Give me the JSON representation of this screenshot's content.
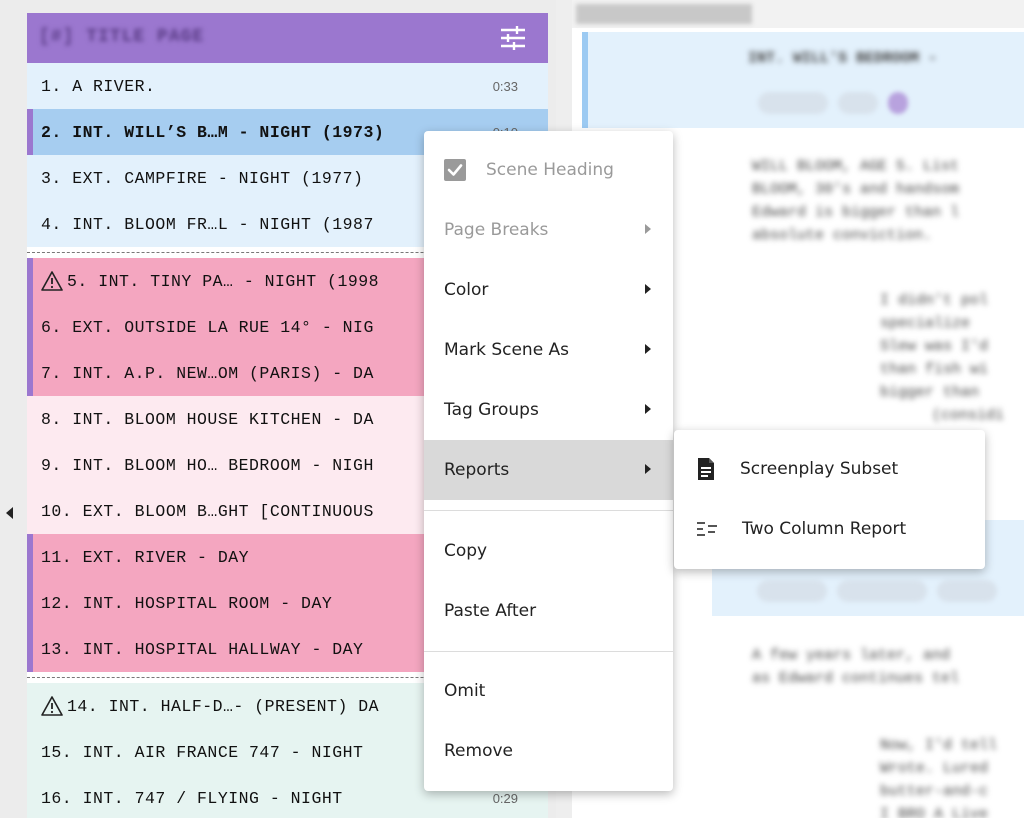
{
  "panel": {
    "title": "[#] TITLE PAGE",
    "filter_icon": "sliders-icon",
    "collapse_icon": "caret-left-icon"
  },
  "scenes_group1": [
    {
      "label": "1. A RIVER.",
      "duration": "0:33",
      "color": "#e3f1fc"
    },
    {
      "label": "2. INT. WILL’S B…M - NIGHT (1973)",
      "duration": "0:10",
      "color": "#a6cdf0",
      "selected": true
    },
    {
      "label": "3. EXT. CAMPFIRE - NIGHT (1977)",
      "duration": "",
      "color": "#e3f1fc"
    },
    {
      "label": "4. INT. BLOOM FR…L - NIGHT (1987",
      "duration": "",
      "color": "#e3f1fc"
    }
  ],
  "scenes_group2": [
    {
      "label": "5. INT. TINY PA… - NIGHT (1998",
      "warning": true,
      "color": "#f4a6c0"
    },
    {
      "label": "6. EXT. OUTSIDE LA RUE 14° - NIG",
      "color": "#f4a6c0"
    },
    {
      "label": "7. INT. A.P. NEW…OM (PARIS) - DA",
      "color": "#f4a6c0"
    },
    {
      "label": "8. INT. BLOOM HOUSE KITCHEN - DA",
      "color": "#fdeaf0"
    },
    {
      "label": "9. INT. BLOOM HO… BEDROOM - NIGH",
      "color": "#fdeaf0"
    },
    {
      "label": "10. EXT. BLOOM B…GHT [CONTINUOUS",
      "color": "#fdeaf0"
    },
    {
      "label": "11. EXT. RIVER - DAY",
      "color": "#f4a6c0"
    },
    {
      "label": "12. INT. HOSPITAL ROOM - DAY",
      "color": "#f4a6c0"
    },
    {
      "label": "13. INT. HOSPITAL HALLWAY - DAY",
      "color": "#f4a6c0"
    }
  ],
  "scenes_group3": [
    {
      "label": "14. INT. HALF-D…- (PRESENT) DA",
      "warning": true,
      "color": "#e6f4f1"
    },
    {
      "label": "15. INT. AIR FRANCE 747 - NIGHT",
      "color": "#e6f4f1"
    },
    {
      "label": "16. INT. 747 / FLYING - NIGHT",
      "duration": "0:29",
      "color": "#e6f4f1"
    }
  ],
  "context_menu": {
    "scene_heading": "Scene Heading",
    "page_breaks": "Page Breaks",
    "color": "Color",
    "mark_scene_as": "Mark Scene As",
    "tag_groups": "Tag Groups",
    "reports": "Reports",
    "copy": "Copy",
    "paste_after": "Paste After",
    "omit": "Omit",
    "remove": "Remove"
  },
  "reports_submenu": {
    "screenplay_subset": "Screenplay Subset",
    "two_column_report": "Two Column Report"
  },
  "editor": {
    "heading": "INT. WILL'S BEDROOM -",
    "lines": [
      "WILL BLOOM, AGE 5. List",
      "BLOOM, 30's and handsom",
      "Edward is bigger than l",
      "absolute conviction."
    ],
    "lines2": [
      "I didn't pol",
      "specialize",
      "Slew was I'd",
      "than fish wi",
      "bigger than",
      "(considi"
    ],
    "lines3": [
      "A few years later, and",
      "as Edward continues tel"
    ],
    "lines4": [
      "Now, I'd tell",
      "Wrote. Lured",
      "butter-and-c",
      "I BRO A Live"
    ]
  }
}
